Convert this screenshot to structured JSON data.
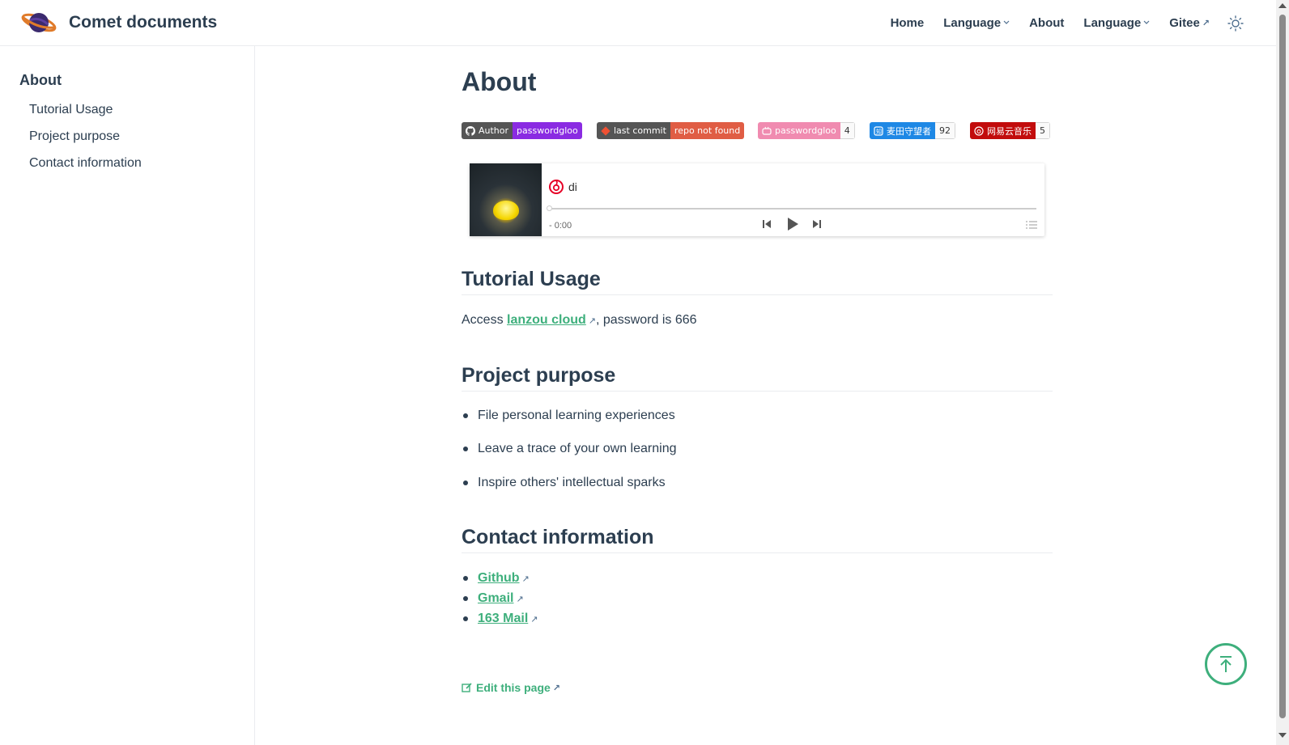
{
  "navbar": {
    "site_name": "Comet documents",
    "links": [
      {
        "label": "Home"
      },
      {
        "label": "Language"
      },
      {
        "label": "About"
      },
      {
        "label": "Language"
      },
      {
        "label": "Gitee"
      }
    ],
    "ext_glyph": "↗",
    "caret_glyph": "⌵"
  },
  "sidebar": {
    "heading": "About",
    "items": [
      {
        "label": "Tutorial Usage"
      },
      {
        "label": "Project purpose"
      },
      {
        "label": "Contact information"
      }
    ]
  },
  "page": {
    "title": "About"
  },
  "badges": [
    {
      "left": "Author",
      "right": "passwordgloo",
      "left_color": "#555555",
      "right_color": "#8a2be2"
    },
    {
      "left": "last commit",
      "right": "repo not found",
      "left_color": "#555555",
      "right_color": "#e05d44"
    },
    {
      "left": "passwordgloo",
      "count": "4",
      "left_color": "#f08bb0"
    },
    {
      "left": "麦田守望者",
      "count": "92",
      "left_color": "#1e88e5"
    },
    {
      "left": "网易云音乐",
      "count": "5",
      "left_color": "#c20c0c"
    }
  ],
  "player": {
    "title": "di",
    "time": "- 0:00",
    "progress": 0
  },
  "sections": {
    "tutorial": {
      "heading": "Tutorial Usage",
      "text_before": "Access ",
      "link": "lanzou cloud",
      "text_after": ", password is 666"
    },
    "purpose": {
      "heading": "Project purpose",
      "items": [
        "File personal learning experiences",
        "Leave a trace of your own learning",
        "Inspire others' intellectual sparks"
      ]
    },
    "contact": {
      "heading": "Contact information",
      "links": [
        "Github",
        "Gmail",
        "163 Mail"
      ]
    }
  },
  "edit_link": "Edit this page",
  "colors": {
    "accent": "#3eaf7c",
    "text": "#2c3e50",
    "border": "#eaecef"
  },
  "icons": {
    "theme": "sun-icon",
    "back_to_top": "arrow-up-icon",
    "edit": "edit-icon"
  }
}
